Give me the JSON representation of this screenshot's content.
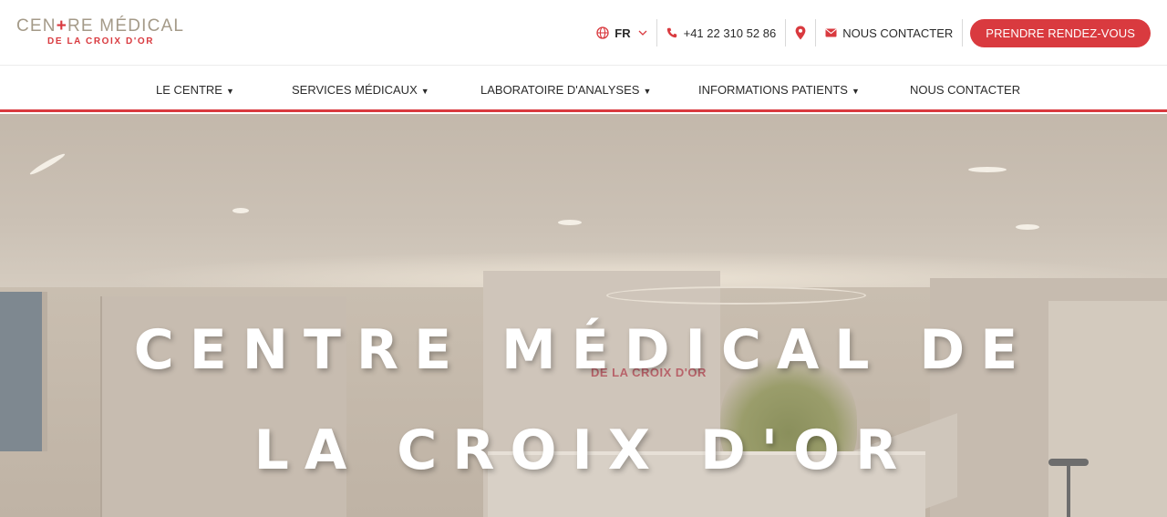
{
  "header": {
    "logo": {
      "line1_before": "CEN",
      "line1_cross": "+",
      "line1_after": "RE MÉDICAL",
      "line2": "DE LA CROIX D'OR"
    },
    "language": {
      "value": "FR",
      "icon": "globe-icon",
      "chevron_icon": "chevron-down-icon"
    },
    "phone": {
      "number": "+41 22 310 52 86",
      "icon": "phone-icon"
    },
    "location": {
      "icon": "map-pin-icon"
    },
    "contact": {
      "label": "NOUS CONTACTER",
      "icon": "envelope-icon"
    },
    "cta": {
      "label": "PRENDRE RENDEZ-VOUS"
    }
  },
  "nav": {
    "items": [
      {
        "label": "LE CENTRE",
        "has_dropdown": true
      },
      {
        "label": "SERVICES MÉDICAUX",
        "has_dropdown": true
      },
      {
        "label": "LABORATOIRE D'ANALYSES",
        "has_dropdown": true
      },
      {
        "label": "INFORMATIONS PATIENTS",
        "has_dropdown": true
      },
      {
        "label": "NOUS CONTACTER",
        "has_dropdown": false
      }
    ],
    "caret_glyph": "▼"
  },
  "hero": {
    "title_line1": "CENTRE MÉDICAL DE",
    "title_line2": "LA CROIX D'OR",
    "wall_sign": "DE LA CROIX D'OR"
  },
  "colors": {
    "accent": "#d93a3f",
    "logo_gold": "#a49a88",
    "text": "#2b2b2b",
    "hero_overlay": "#bfb3a6"
  }
}
